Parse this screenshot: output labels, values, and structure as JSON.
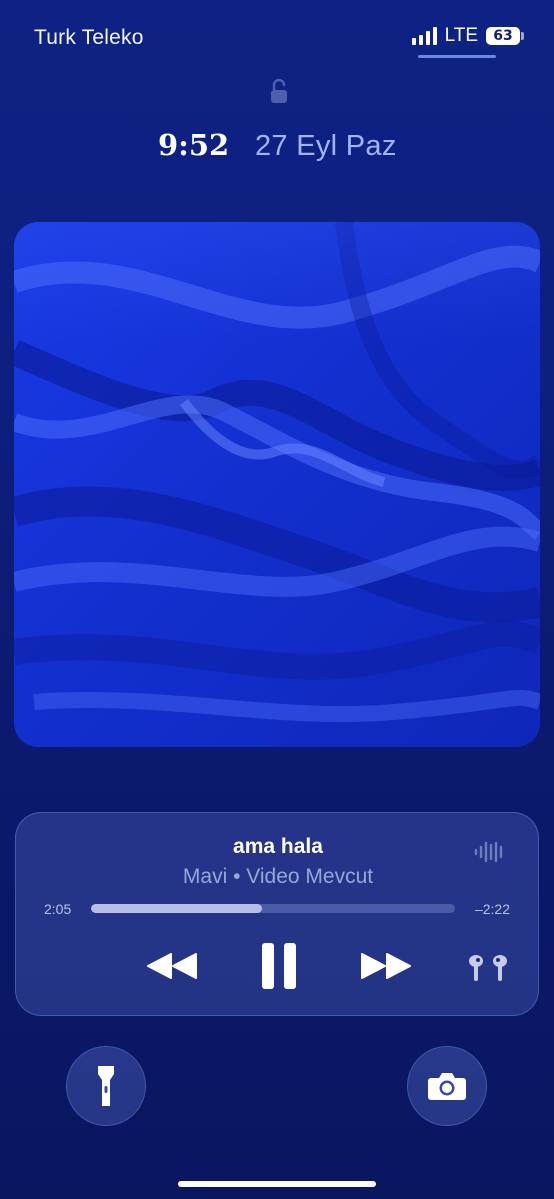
{
  "status_bar": {
    "carrier": "Turk Teleko",
    "network": "LTE",
    "battery_level": "63",
    "signal_bars": 4,
    "accent_color": "#6d86e8"
  },
  "lock_screen": {
    "time": "9:52",
    "date": "27 Eyl Paz",
    "lock_icon": "lock-icon"
  },
  "artwork": {
    "description_icon": "album-artwork",
    "color": "#1530d6"
  },
  "now_playing": {
    "title": "ama hala",
    "subtitle": "Mavi • Video Mevcut",
    "elapsed": "2:05",
    "remaining": "–2:22",
    "progress": 0.47,
    "controls": {
      "rewind_icon": "rewind-icon",
      "pause_icon": "pause-icon",
      "forward_icon": "fast-forward-icon",
      "output_icon": "airpods-icon",
      "waveform_icon": "waveform-icon"
    }
  },
  "quick_actions": {
    "left_icon": "flashlight-icon",
    "right_icon": "camera-icon"
  }
}
